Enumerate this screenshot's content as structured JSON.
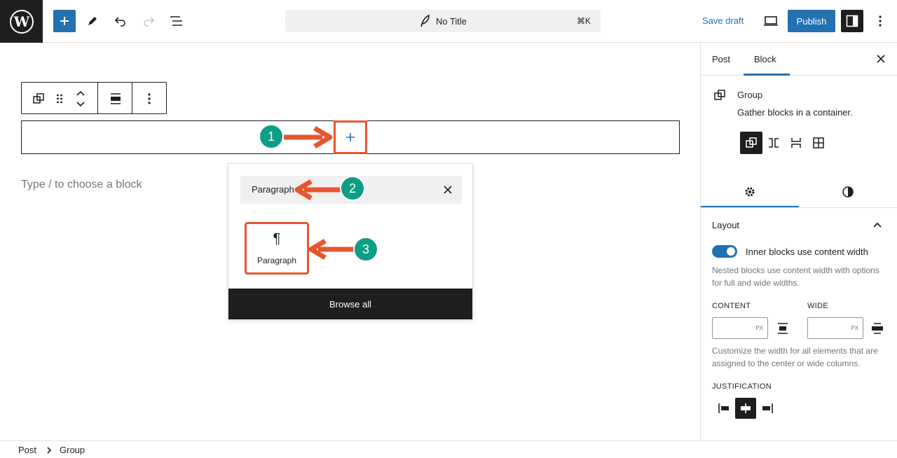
{
  "topbar": {
    "title": "No Title",
    "shortcut": "⌘K",
    "save_draft": "Save draft",
    "publish": "Publish"
  },
  "canvas": {
    "placeholder": "Type / to choose a block"
  },
  "inserter_popover": {
    "search_value": "Paragraph",
    "result_icon": "¶",
    "result_label": "Paragraph",
    "browse_all": "Browse all"
  },
  "annotations": {
    "steps": [
      "1",
      "2",
      "3"
    ],
    "color_step": "#0d9e86",
    "color_arrow": "#e8552d"
  },
  "sidebar": {
    "tabs": [
      "Post",
      "Block"
    ],
    "active_tab": "Block",
    "block_name": "Group",
    "block_desc": "Gather blocks in a container.",
    "layout": {
      "title": "Layout",
      "toggle_label": "Inner blocks use content width",
      "toggle_on": true,
      "toggle_help": "Nested blocks use content width with options for full and wide widths.",
      "content_label": "CONTENT",
      "wide_label": "WIDE",
      "unit": "PX",
      "width_help": "Customize the width for all elements that are assigned to the center or wide columns.",
      "justification_label": "JUSTIFICATION"
    }
  },
  "footer": {
    "breadcrumbs": [
      "Post",
      "Group"
    ]
  },
  "colors": {
    "accent": "#2271b1",
    "dark": "#1e1e1e"
  }
}
